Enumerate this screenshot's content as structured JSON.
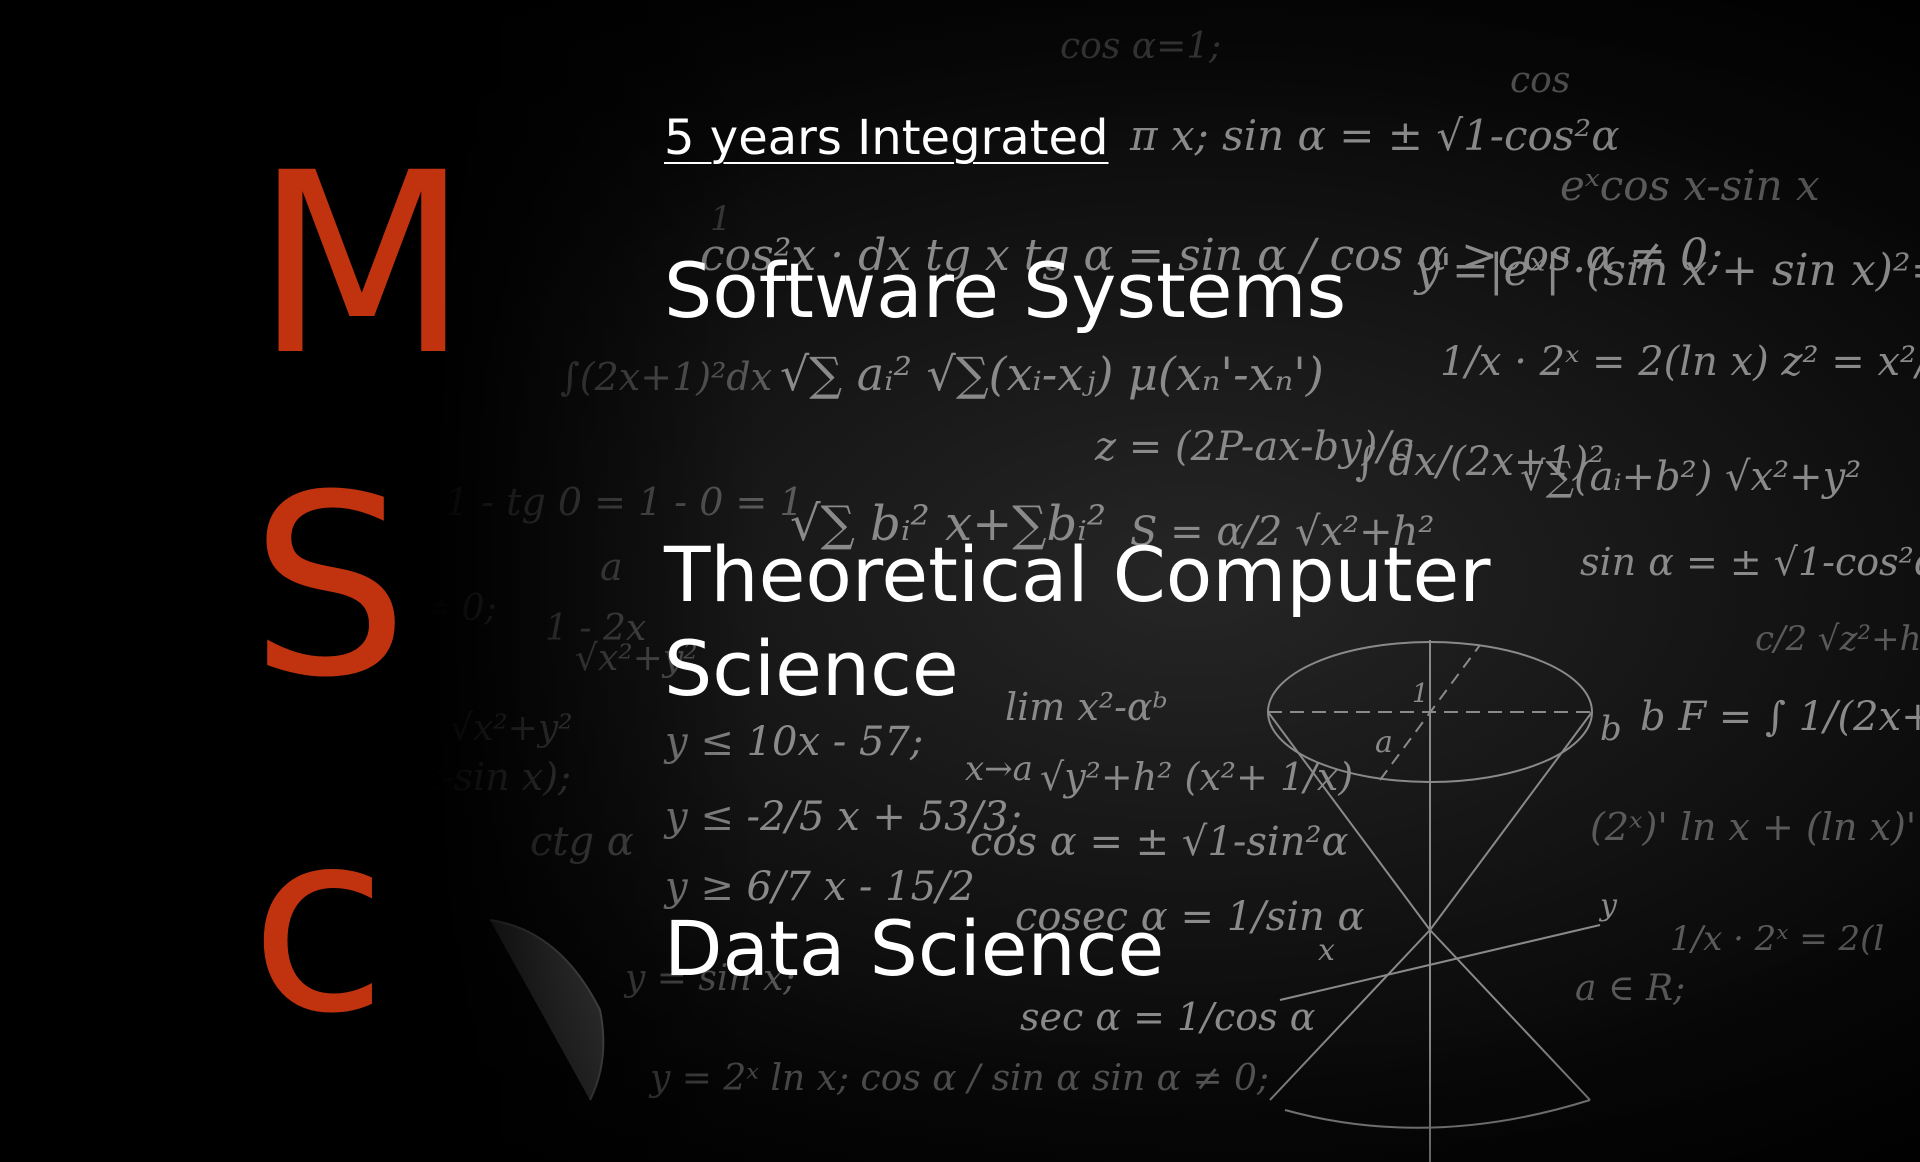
{
  "slide": {
    "background": "chalkboard math formulas",
    "accent_color": "#c1330f",
    "text_color": "#ffffff"
  },
  "acronym": {
    "letters": [
      "M",
      "S",
      "c"
    ]
  },
  "subtitle": "5 years Integrated",
  "programs": [
    "Software Systems",
    "Theoretical Computer Science",
    "Data Science"
  ]
}
